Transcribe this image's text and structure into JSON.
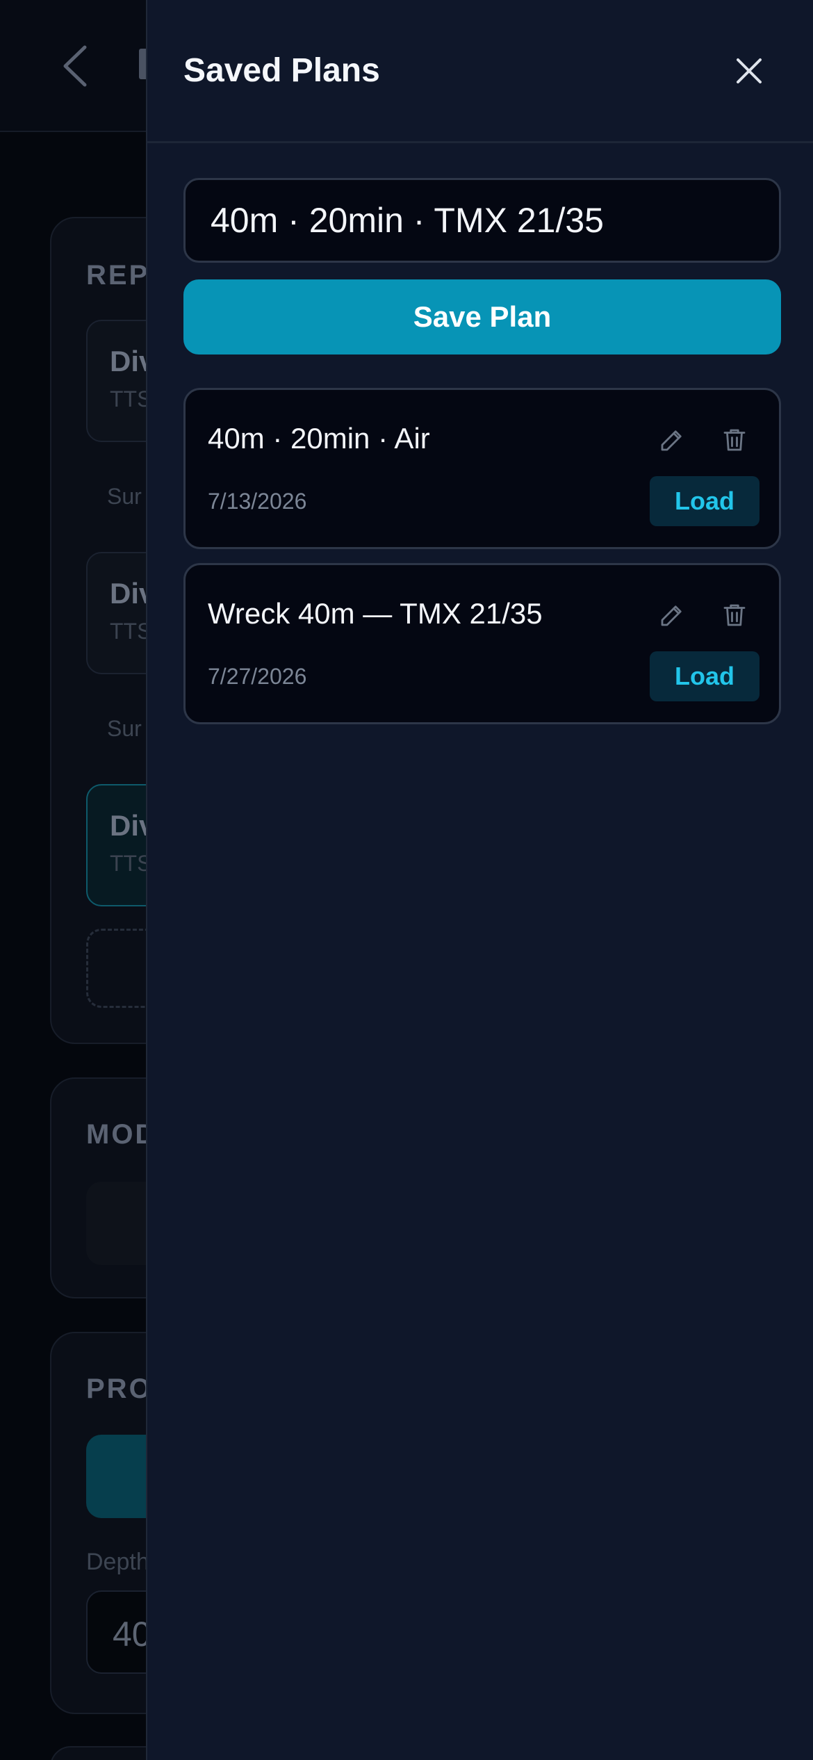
{
  "background": {
    "sections": {
      "repeat": "REP",
      "mode": "MOD",
      "profile": "PRO"
    },
    "dives": [
      {
        "title": "Div",
        "sub": "TTS"
      },
      {
        "title": "Div",
        "sub": "TTS"
      },
      {
        "title": "Div",
        "sub": "TTS"
      }
    ],
    "surface_labels": [
      "Sur",
      "Sur"
    ],
    "depth_label": "Depth",
    "depth_value": "40"
  },
  "drawer": {
    "title": "Saved Plans",
    "name_input": {
      "value": "40m · 20min · TMX 21/35",
      "placeholder": ""
    },
    "save_label": "Save Plan",
    "plans": [
      {
        "name": "40m · 20min · Air",
        "date": "7/13/2026",
        "load_label": "Load"
      },
      {
        "name": "Wreck 40m — TMX 21/35",
        "date": "7/27/2026",
        "load_label": "Load"
      }
    ]
  },
  "colors": {
    "drawer_bg": "#0f172a",
    "accent": "#0794b6",
    "load_text": "#22c5ea"
  },
  "icons": {
    "close": "close-icon",
    "edit": "edit-icon",
    "delete": "trash-icon",
    "back": "chevron-left-icon"
  }
}
